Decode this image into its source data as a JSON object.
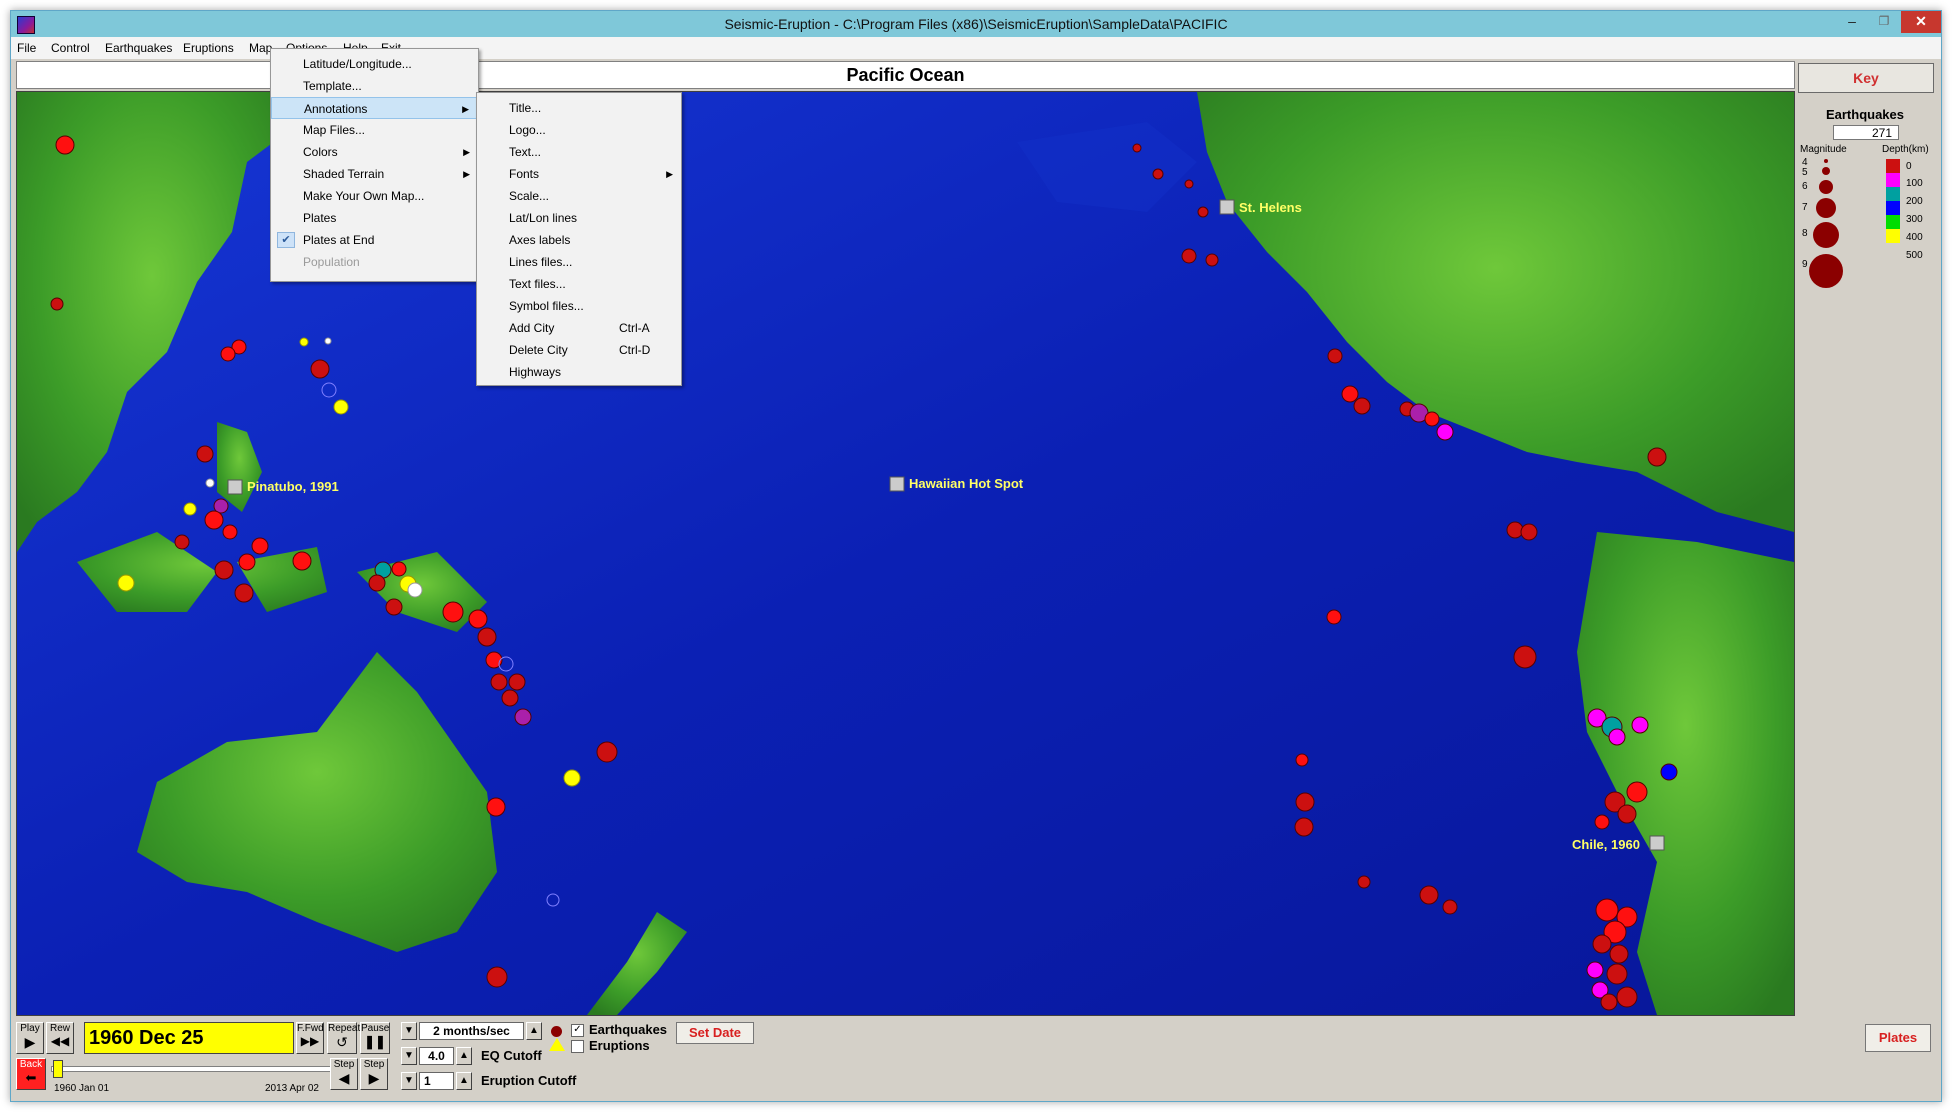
{
  "window": {
    "title": "Seismic-Eruption - C:\\Program Files (x86)\\SeismicEruption\\SampleData\\PACIFIC",
    "minimize": "–",
    "maximize": "❐",
    "close": "✕"
  },
  "menubar": [
    "File",
    "Control",
    "Earthquakes",
    "Eruptions",
    "Map",
    "Options",
    "Help",
    "Exit"
  ],
  "map_title": "Pacific Ocean",
  "map_menu": {
    "items": [
      {
        "label": "Latitude/Longitude..."
      },
      {
        "label": "Template..."
      },
      {
        "label": "Annotations",
        "submenu": true,
        "highlighted": true
      },
      {
        "label": "Map Files..."
      },
      {
        "label": "Colors",
        "submenu": true
      },
      {
        "label": "Shaded Terrain",
        "submenu": true
      },
      {
        "label": "Make Your Own Map..."
      },
      {
        "label": "Plates"
      },
      {
        "label": "Plates at End",
        "checked": true
      },
      {
        "label": "Population",
        "disabled": true
      }
    ]
  },
  "annotations_menu": {
    "items": [
      {
        "label": "Title...",
        "shortcut": ""
      },
      {
        "label": "Logo...",
        "shortcut": ""
      },
      {
        "label": "Text...",
        "shortcut": ""
      },
      {
        "label": "Fonts",
        "shortcut": "",
        "submenu": true
      },
      {
        "label": "Scale...",
        "shortcut": ""
      },
      {
        "label": "Lat/Lon lines",
        "shortcut": ""
      },
      {
        "label": "Axes labels",
        "shortcut": ""
      },
      {
        "label": "Lines files...",
        "shortcut": ""
      },
      {
        "label": "Text files...",
        "shortcut": ""
      },
      {
        "label": "Symbol files...",
        "shortcut": ""
      },
      {
        "label": "Add City",
        "shortcut": "Ctrl-A"
      },
      {
        "label": "Delete City",
        "shortcut": "Ctrl-D"
      },
      {
        "label": "Highways",
        "shortcut": ""
      }
    ]
  },
  "map_labels": [
    "St. Helens",
    "Pinatubo, 1991",
    "Hawaiian Hot Spot",
    "Chile, 1960"
  ],
  "key_panel": {
    "button": "Key",
    "heading": "Earthquakes",
    "count": "271",
    "magnitude_label": "Magnitude",
    "depth_label": "Depth(km)",
    "magnitudes": [
      "4",
      "5",
      "6",
      "7",
      "8",
      "9"
    ],
    "depths": [
      "0",
      "100",
      "200",
      "300",
      "400",
      "500"
    ],
    "depth_colors": [
      "#cc1010",
      "#ff00ff",
      "#00a0a0",
      "#0000ff",
      "#00dd00",
      "#ffff00"
    ]
  },
  "controls": {
    "play": "Play",
    "rew": "Rew",
    "ffwd": "F.Fwd",
    "repeat": "Repeat",
    "pause": "Pause",
    "back": "Back",
    "step_back": "Step",
    "step_fwd": "Step",
    "date": "1960 Dec 25",
    "start_date": "1960 Jan 01",
    "end_date": "2013 Apr 02",
    "speed": "2 months/sec",
    "eq_cutoff_value": "4.0",
    "eq_cutoff_label": "EQ Cutoff",
    "eruption_cutoff_value": "1",
    "eruption_cutoff_label": "Eruption Cutoff",
    "earthquakes_label": "Earthquakes",
    "eruptions_label": "Eruptions",
    "set_date": "Set Date",
    "plates": "Plates",
    "slider_position": 0.01
  }
}
